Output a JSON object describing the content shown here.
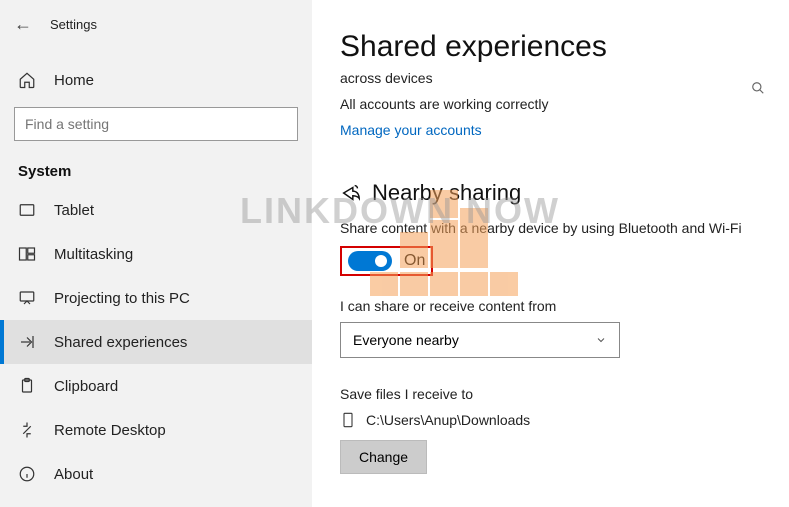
{
  "window": {
    "title": "Settings"
  },
  "sidebar": {
    "home": "Home",
    "search_placeholder": "Find a setting",
    "category": "System",
    "items": [
      {
        "label": "Tablet"
      },
      {
        "label": "Multitasking"
      },
      {
        "label": "Projecting to this PC"
      },
      {
        "label": "Shared experiences"
      },
      {
        "label": "Clipboard"
      },
      {
        "label": "Remote Desktop"
      },
      {
        "label": "About"
      }
    ]
  },
  "main": {
    "heading": "Shared experiences",
    "line1": "across devices",
    "line2": "All accounts are working correctly",
    "manage_link": "Manage your accounts",
    "nearby": {
      "title": "Nearby sharing",
      "desc": "Share content with a nearby device by using Bluetooth and Wi-Fi",
      "toggle_state": "On",
      "share_from_label": "I can share or receive content from",
      "share_from_value": "Everyone nearby",
      "save_to_label": "Save files I receive to",
      "save_path": "C:\\Users\\Anup\\Downloads",
      "change_btn": "Change"
    }
  },
  "watermark": "LINKDOWN NOW"
}
